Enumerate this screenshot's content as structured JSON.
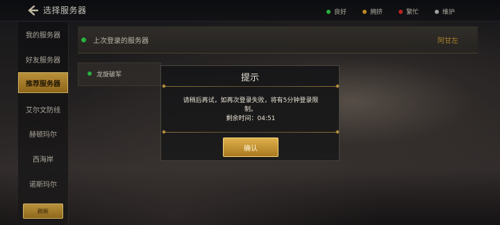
{
  "header": {
    "title": "选择服务器",
    "legend": [
      {
        "label": "良好",
        "color": "#2fd04a"
      },
      {
        "label": "拥挤",
        "color": "#e0a12a"
      },
      {
        "label": "繁忙",
        "color": "#e02a2a"
      },
      {
        "label": "维护",
        "color": "#bdbdbd"
      }
    ]
  },
  "sidebar": {
    "items": [
      {
        "label": "我的服务器",
        "active": false
      },
      {
        "label": "好友服务器",
        "active": false
      },
      {
        "label": "推荐服务器",
        "active": true
      },
      {
        "label": "艾尔文防线",
        "active": false
      },
      {
        "label": "赫顿玛尔",
        "active": false
      },
      {
        "label": "西海岸",
        "active": false
      },
      {
        "label": "诺斯玛尔",
        "active": false
      }
    ],
    "refresh_label": "刷新"
  },
  "last_login": {
    "label": "上次登录的服务器",
    "server": "阿甘左"
  },
  "servers": [
    {
      "name": "龙旋破军",
      "status_color": "#2fd04a"
    }
  ],
  "dialog": {
    "title": "提示",
    "message_line1": "请稍后再试，如再次登录失败，将有5分钟登录限",
    "message_line2": "制。",
    "message_line3": "剩余时间：04:51",
    "confirm_label": "确认"
  }
}
